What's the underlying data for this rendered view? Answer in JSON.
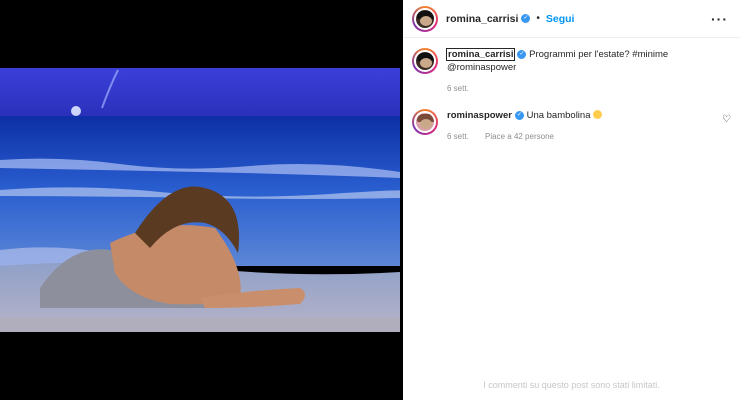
{
  "post": {
    "author": "romina_carrisi",
    "follow_label": "Segui",
    "dot": "•",
    "more_label": "···"
  },
  "caption": {
    "username": "romina_carrisi",
    "text": "Programmi per l'estate? #minime",
    "mention": "@rominaspower",
    "time": "6 sett."
  },
  "comments": [
    {
      "username": "rominaspower",
      "text": "Una bambolina",
      "time": "6 sett.",
      "likes": "Piace a 42 persone"
    }
  ],
  "footer": {
    "limited_text": "I commenti su questo post sono stati limitati."
  },
  "colors": {
    "accent": "#0095f6",
    "verified": "#3897f0",
    "sea": "#1c3fc7"
  }
}
